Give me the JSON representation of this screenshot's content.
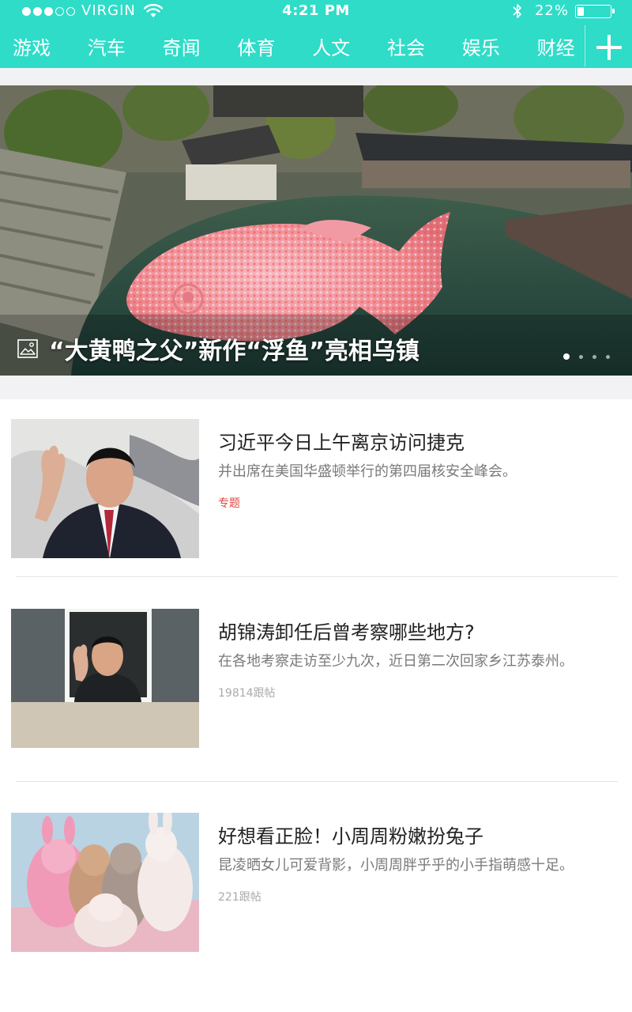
{
  "status_bar": {
    "carrier": "VIRGIN",
    "time": "4:21 PM",
    "battery_percent": "22%",
    "battery_level": 0.22
  },
  "nav": {
    "tabs": [
      "游戏",
      "汽车",
      "奇闻",
      "体育",
      "人文",
      "社会",
      "娱乐",
      "财经"
    ],
    "add_icon": "plus-icon"
  },
  "hero": {
    "title": "“大黄鸭之父”新作“浮鱼”亮相乌镇",
    "icon": "photo-icon",
    "page_count": 4,
    "active_page": 1
  },
  "articles": [
    {
      "title": "习近平今日上午离京访问捷克",
      "description": "并出席在美国华盛顿举行的第四届核安全峰会。",
      "meta": "专题",
      "meta_type": "topic"
    },
    {
      "title": "胡锦涛卸任后曾考察哪些地方?",
      "description": "在各地考察走访至少九次，近日第二次回家乡江苏泰州。",
      "meta": "19814跟帖",
      "meta_type": "comments"
    },
    {
      "title": "好想看正脸！小周周粉嫩扮兔子",
      "description": "昆凌晒女儿可爱背影，小周周胖乎乎的小手指萌感十足。",
      "meta": "221跟帖",
      "meta_type": "comments"
    }
  ],
  "colors": {
    "accent": "#2fdcc8",
    "topic_tag": "#e0493f",
    "meta_gray": "#aaaaaa"
  }
}
